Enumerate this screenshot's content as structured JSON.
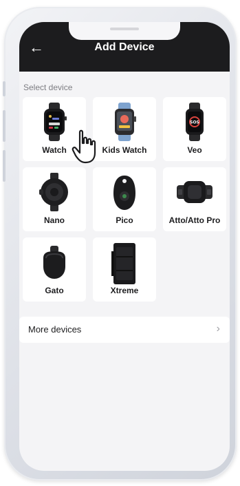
{
  "header": {
    "title": "Add Device",
    "back_icon": "arrow-left-icon"
  },
  "section_label": "Select device",
  "devices": [
    {
      "label": "Watch",
      "icon": "watch-icon"
    },
    {
      "label": "Kids Watch",
      "icon": "kids-watch-icon"
    },
    {
      "label": "Veo",
      "icon": "veo-watch-icon"
    },
    {
      "label": "Nano",
      "icon": "nano-tracker-icon"
    },
    {
      "label": "Pico",
      "icon": "pico-tracker-icon"
    },
    {
      "label": "Atto/Atto Pro",
      "icon": "atto-tracker-icon"
    },
    {
      "label": "Gato",
      "icon": "gato-tracker-icon"
    },
    {
      "label": "Xtreme",
      "icon": "xtreme-tracker-icon"
    }
  ],
  "more_devices": {
    "label": "More devices",
    "chevron": "›"
  },
  "veo_screen_text": "SOS",
  "colors": {
    "header_bg": "#1c1c1e",
    "screen_bg": "#f4f4f6",
    "kids_watch_band": "#7ea3cf"
  }
}
